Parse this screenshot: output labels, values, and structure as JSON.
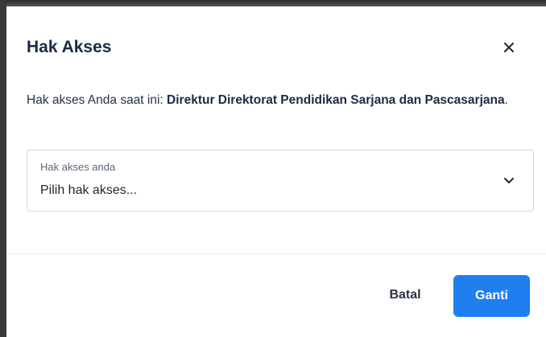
{
  "modal": {
    "title": "Hak Akses",
    "close_icon": "close-icon",
    "body": {
      "prefix": "Hak akses Anda saat ini: ",
      "current_role": "Direktur Direktorat Pendidikan Sarjana dan Pascasarjana",
      "suffix": "."
    },
    "select": {
      "label": "Hak akses anda",
      "value": "Pilih hak akses...",
      "icon": "chevron-down-icon"
    },
    "footer": {
      "cancel_label": "Batal",
      "submit_label": "Ganti"
    }
  },
  "colors": {
    "primary": "#1f7ff0",
    "title": "#1a2b45",
    "border": "#d2d7df",
    "backdrop": "#3a3a3a"
  }
}
